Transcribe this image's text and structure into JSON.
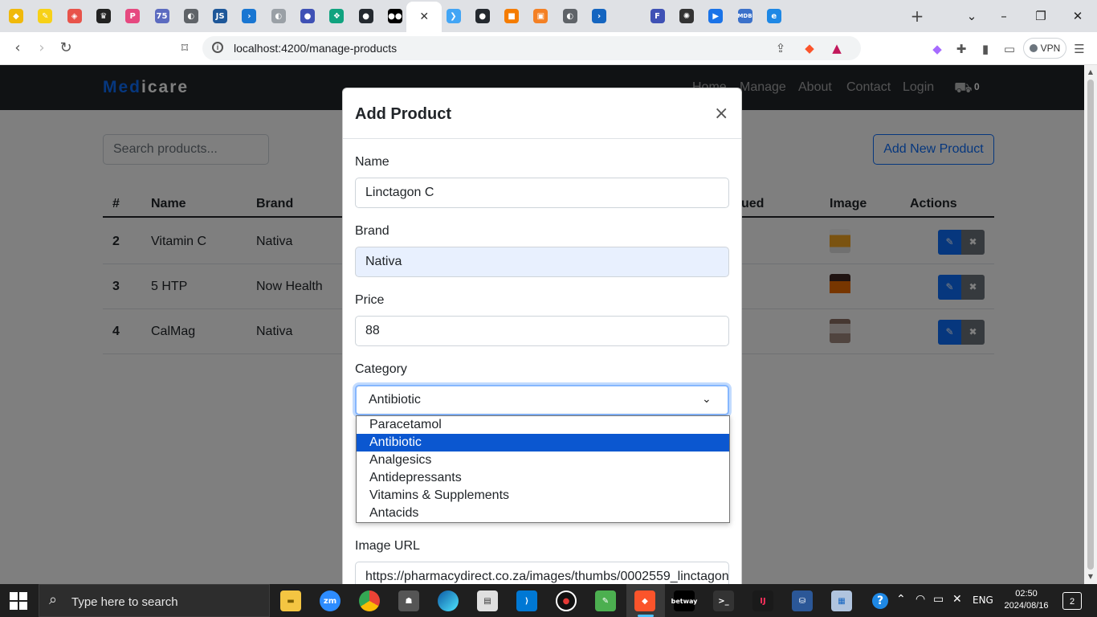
{
  "browser": {
    "tabs": [
      {
        "icon": "binance-icon",
        "glyph": "◆",
        "color": "#f0b90b"
      },
      {
        "icon": "pencil-app-icon",
        "glyph": "✎",
        "color": "#f7d117"
      },
      {
        "icon": "shield-app-icon",
        "glyph": "◈",
        "color": "#e8534a"
      },
      {
        "icon": "crown-icon",
        "glyph": "♛",
        "color": "#222222"
      },
      {
        "icon": "p-app-icon",
        "glyph": "P",
        "color": "#e64980"
      },
      {
        "icon": "75-app-icon",
        "glyph": "75",
        "color": "#5c6bc0"
      },
      {
        "icon": "globe-icon",
        "glyph": "◐",
        "color": "#5f6368"
      },
      {
        "icon": "js-app-icon",
        "glyph": "JS",
        "color": "#1e5799"
      },
      {
        "icon": "terminal-app-icon",
        "glyph": "›",
        "color": "#1976d2"
      },
      {
        "icon": "globe-icon",
        "glyph": "◐",
        "color": "#9aa0a6"
      },
      {
        "icon": "chat-app-icon",
        "glyph": "●",
        "color": "#3f51b5"
      },
      {
        "icon": "openai-icon",
        "glyph": "❖",
        "color": "#10a37f"
      },
      {
        "icon": "github-icon",
        "glyph": "●",
        "color": "#24292f"
      },
      {
        "icon": "medium-icon",
        "glyph": "●●",
        "color": "#000000"
      },
      {
        "icon": "active-tab",
        "glyph": "",
        "color": "#ffffff"
      },
      {
        "icon": "flutter-icon",
        "glyph": "❯",
        "color": "#42a5f5"
      },
      {
        "icon": "github-icon",
        "glyph": "●",
        "color": "#24292f"
      },
      {
        "icon": "box-app-icon",
        "glyph": "■",
        "color": "#f57c00"
      },
      {
        "icon": "stackoverflow-icon",
        "glyph": "▣",
        "color": "#f48024"
      },
      {
        "icon": "globe-icon",
        "glyph": "◐",
        "color": "#5f6368"
      },
      {
        "icon": "powershell-icon",
        "glyph": "›",
        "color": "#1565c0"
      },
      {
        "icon": "blank-tab-icon",
        "glyph": "",
        "color": "#dfe1e5"
      },
      {
        "icon": "form-app-icon",
        "glyph": "F",
        "color": "#3f51b5"
      },
      {
        "icon": "chatgpt-icon",
        "glyph": "✺",
        "color": "#333333"
      },
      {
        "icon": "play-app-icon",
        "glyph": "▶",
        "color": "#1a73e8"
      },
      {
        "icon": "mdb-icon",
        "glyph": "MDB",
        "color": "#3b71ca"
      },
      {
        "icon": "edge-tab-icon",
        "glyph": "e",
        "color": "#1e88e5"
      }
    ],
    "active_tab_close": "✕",
    "new_tab": "+",
    "url": "localhost:4200/manage-products",
    "vpn_label": "VPN"
  },
  "navbar": {
    "brand_part1": "Med",
    "brand_part2": "icare",
    "links": [
      "Home",
      "Manage",
      "About",
      "Contact",
      "Login"
    ],
    "cart_count": "0"
  },
  "page": {
    "search_placeholder": "Search products...",
    "add_new_label": "Add New Product"
  },
  "table": {
    "headers": [
      "#",
      "Name",
      "Brand",
      "ued",
      "Image",
      "Actions"
    ],
    "rows": [
      {
        "id": "2",
        "name": "Vitamin C",
        "brand": "Nativa"
      },
      {
        "id": "3",
        "name": "5 HTP",
        "brand": "Now Health"
      },
      {
        "id": "4",
        "name": "CalMag",
        "brand": "Nativa"
      }
    ]
  },
  "modal": {
    "title": "Add Product",
    "close": "×",
    "name_label": "Name",
    "name_value": "Linctagon C",
    "brand_label": "Brand",
    "brand_value": "Nativa",
    "price_label": "Price",
    "price_value": "88",
    "category_label": "Category",
    "category_value": "Antibiotic",
    "category_options": [
      "Paracetamol",
      "Antibiotic",
      "Analgesics",
      "Antidepressants",
      "Vitamins & Supplements",
      "Antacids"
    ],
    "image_label": "Image URL",
    "image_value": "https://pharmacydirect.co.za/images/thumbs/0002559_linctagon"
  },
  "taskbar": {
    "search_text": "Type here to search",
    "time": "02:50",
    "date": "2024/08/16",
    "language": "ENG",
    "notifications": "2"
  }
}
